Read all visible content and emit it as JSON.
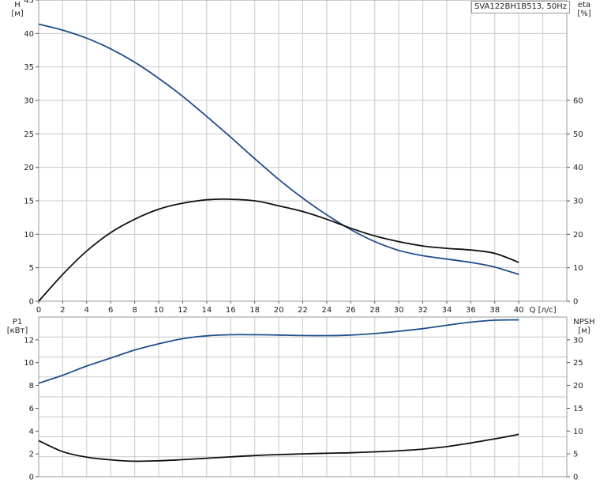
{
  "title": "SVA122BH1B513, 50Hz",
  "colors": {
    "blue": "#1f4e8c",
    "black": "#111111",
    "grid": "#c8c8c8",
    "frame": "#9a9a9a"
  },
  "chart_data": [
    {
      "name": "performance",
      "type": "line",
      "grid": true,
      "x_axis": {
        "label": "Q [л/с]",
        "range": [
          0,
          44
        ],
        "ticks": [
          0,
          2,
          4,
          6,
          8,
          10,
          12,
          14,
          16,
          18,
          20,
          22,
          24,
          26,
          28,
          30,
          32,
          34,
          36,
          38,
          40
        ]
      },
      "y_left": {
        "label_top": "H",
        "label_unit": "[м]",
        "range": [
          0,
          45
        ],
        "ticks": [
          0,
          5,
          10,
          15,
          20,
          25,
          30,
          35,
          40,
          45
        ]
      },
      "y_right": {
        "label_top": "eta",
        "label_unit": "[%]",
        "range": [
          0,
          90
        ],
        "ticks": [
          0,
          10,
          20,
          30,
          40,
          50,
          60
        ]
      },
      "series": [
        {
          "axis": "left",
          "color": "#1f4e8c",
          "points": [
            [
              0,
              41.4
            ],
            [
              2,
              40.5
            ],
            [
              4,
              39.3
            ],
            [
              6,
              37.7
            ],
            [
              8,
              35.7
            ],
            [
              10,
              33.3
            ],
            [
              12,
              30.6
            ],
            [
              14,
              27.6
            ],
            [
              16,
              24.5
            ],
            [
              18,
              21.3
            ],
            [
              20,
              18.2
            ],
            [
              22,
              15.4
            ],
            [
              24,
              12.9
            ],
            [
              26,
              10.7
            ],
            [
              28,
              8.9
            ],
            [
              30,
              7.6
            ],
            [
              32,
              6.8
            ],
            [
              34,
              6.3
            ],
            [
              36,
              5.8
            ],
            [
              38,
              5.1
            ],
            [
              40,
              4.0
            ]
          ]
        },
        {
          "axis": "right",
          "color": "#111111",
          "points": [
            [
              0,
              0
            ],
            [
              2,
              8
            ],
            [
              4,
              15
            ],
            [
              6,
              20.5
            ],
            [
              8,
              24.5
            ],
            [
              10,
              27.5
            ],
            [
              12,
              29.3
            ],
            [
              14,
              30.3
            ],
            [
              15.5,
              30.5
            ],
            [
              18,
              30
            ],
            [
              20,
              28.5
            ],
            [
              22,
              26.8
            ],
            [
              24,
              24.5
            ],
            [
              26,
              21.8
            ],
            [
              28,
              19.5
            ],
            [
              30,
              17.8
            ],
            [
              32,
              16.5
            ],
            [
              34,
              15.8
            ],
            [
              36,
              15.3
            ],
            [
              38,
              14.3
            ],
            [
              40,
              11.6
            ]
          ]
        }
      ]
    },
    {
      "name": "power-npsh",
      "type": "line",
      "grid": true,
      "x_axis": {
        "range": [
          0,
          44
        ]
      },
      "y_left": {
        "label_top": "P1",
        "label_unit": "[кВт]",
        "range": [
          0,
          14
        ],
        "ticks": [
          0,
          2,
          4,
          6,
          8,
          10,
          12
        ]
      },
      "y_right": {
        "label_top": "NPSH",
        "label_unit": "[м]",
        "range": [
          0,
          35
        ],
        "ticks": [
          0,
          5,
          10,
          15,
          20,
          25,
          30
        ]
      },
      "series": [
        {
          "axis": "left",
          "color": "#1f4e8c",
          "points": [
            [
              0,
              8.2
            ],
            [
              2,
              8.9
            ],
            [
              4,
              9.7
            ],
            [
              6,
              10.4
            ],
            [
              8,
              11.1
            ],
            [
              10,
              11.65
            ],
            [
              12,
              12.1
            ],
            [
              14,
              12.35
            ],
            [
              16,
              12.45
            ],
            [
              18,
              12.45
            ],
            [
              20,
              12.42
            ],
            [
              22,
              12.38
            ],
            [
              24,
              12.37
            ],
            [
              26,
              12.42
            ],
            [
              28,
              12.55
            ],
            [
              30,
              12.75
            ],
            [
              32,
              12.98
            ],
            [
              34,
              13.28
            ],
            [
              36,
              13.55
            ],
            [
              38,
              13.72
            ],
            [
              40,
              13.75
            ]
          ]
        },
        {
          "axis": "right",
          "color": "#111111",
          "points": [
            [
              0,
              7.9
            ],
            [
              2,
              5.5
            ],
            [
              4,
              4.3
            ],
            [
              6,
              3.7
            ],
            [
              8,
              3.4
            ],
            [
              10,
              3.5
            ],
            [
              12,
              3.75
            ],
            [
              14,
              4.05
            ],
            [
              16,
              4.35
            ],
            [
              18,
              4.65
            ],
            [
              20,
              4.85
            ],
            [
              22,
              5.0
            ],
            [
              24,
              5.15
            ],
            [
              26,
              5.25
            ],
            [
              28,
              5.45
            ],
            [
              30,
              5.7
            ],
            [
              32,
              6.05
            ],
            [
              34,
              6.6
            ],
            [
              36,
              7.4
            ],
            [
              38,
              8.3
            ],
            [
              40,
              9.3
            ]
          ]
        }
      ]
    }
  ]
}
